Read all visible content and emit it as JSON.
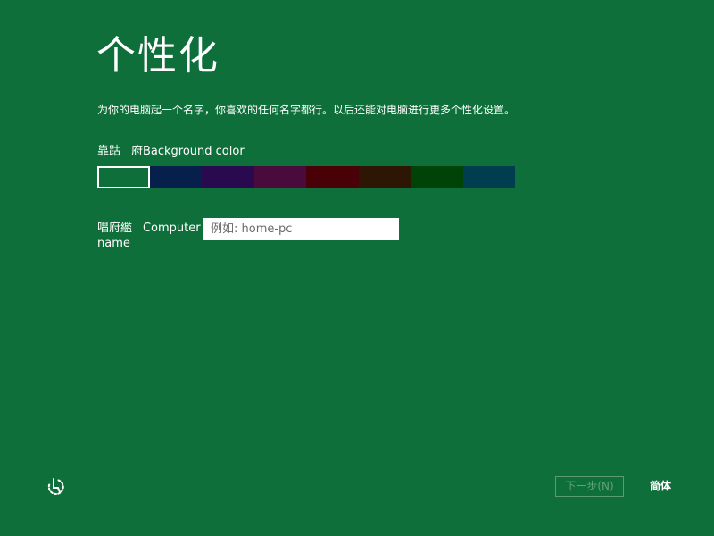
{
  "header": {
    "title": "个性化",
    "subtitle": "为你的电脑起一个名字，你喜欢的任何名字都行。以后还能对电脑进行更多个性化设置。"
  },
  "background": {
    "label": "靠跍ᅟ府Background color",
    "swatches": [
      {
        "color": "#0f6f3a",
        "selected": true
      },
      {
        "color": "#06204b",
        "selected": false
      },
      {
        "color": "#2a0a4f",
        "selected": false
      },
      {
        "color": "#4a0a3c",
        "selected": false
      },
      {
        "color": "#4a0007",
        "selected": false
      },
      {
        "color": "#2d1603",
        "selected": false
      },
      {
        "color": "#004307",
        "selected": false
      },
      {
        "color": "#003d4f",
        "selected": false
      }
    ]
  },
  "computer_name": {
    "label": "唱府繿ᅟComputer name",
    "value": "",
    "placeholder": "例如: home-pc"
  },
  "footer": {
    "ease_icon": "ease-of-access-icon",
    "next_label": "下一步(N)",
    "next_enabled": false,
    "language_label": "简体"
  },
  "colors": {
    "background": "#0f6f3a",
    "text": "#ffffff",
    "disabled_button_text": "#5fa37a",
    "disabled_button_border": "#5a9a74",
    "input_background": "#ffffff"
  }
}
